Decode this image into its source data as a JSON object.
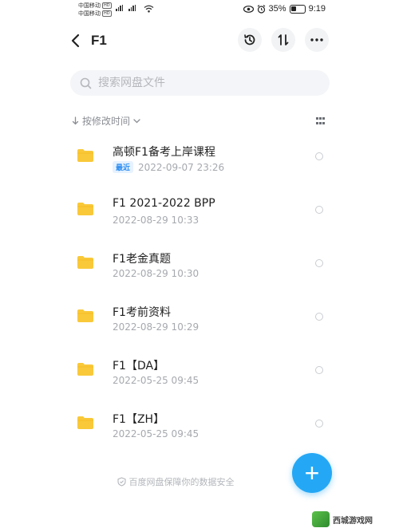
{
  "status_bar": {
    "carrier_1": "中国移动",
    "carrier_2": "中国移动",
    "hd_1": "HD",
    "hd_2": "HD",
    "battery_percent": "35%",
    "time": "9:19"
  },
  "header": {
    "title": "F1",
    "icons": [
      "back-arrow-icon",
      "history-icon",
      "sort-icon",
      "more-icon"
    ]
  },
  "search": {
    "placeholder": "搜索网盘文件"
  },
  "sort_bar": {
    "label": "按修改时间"
  },
  "files": [
    {
      "name": "高顿F1备考上岸课程",
      "badge": "最近",
      "date": "2022-09-07 23:26"
    },
    {
      "name": "F1 2021-2022 BPP",
      "badge": "",
      "date": "2022-08-29 10:33"
    },
    {
      "name": "F1老金真题",
      "badge": "",
      "date": "2022-08-29 10:30"
    },
    {
      "name": "F1考前资料",
      "badge": "",
      "date": "2022-08-29 10:29"
    },
    {
      "name": "F1【DA】",
      "badge": "",
      "date": "2022-05-25 09:45"
    },
    {
      "name": "F1【ZH】",
      "badge": "",
      "date": "2022-05-25 09:45"
    }
  ],
  "footer": {
    "text": "百度网盘保障你的数据安全"
  },
  "fab": {
    "label": "+"
  },
  "watermark": {
    "text": "西城游戏网"
  },
  "colors": {
    "accent": "#24a8f5",
    "folder": "#f9c93a",
    "badge_text": "#2a8cf0"
  }
}
